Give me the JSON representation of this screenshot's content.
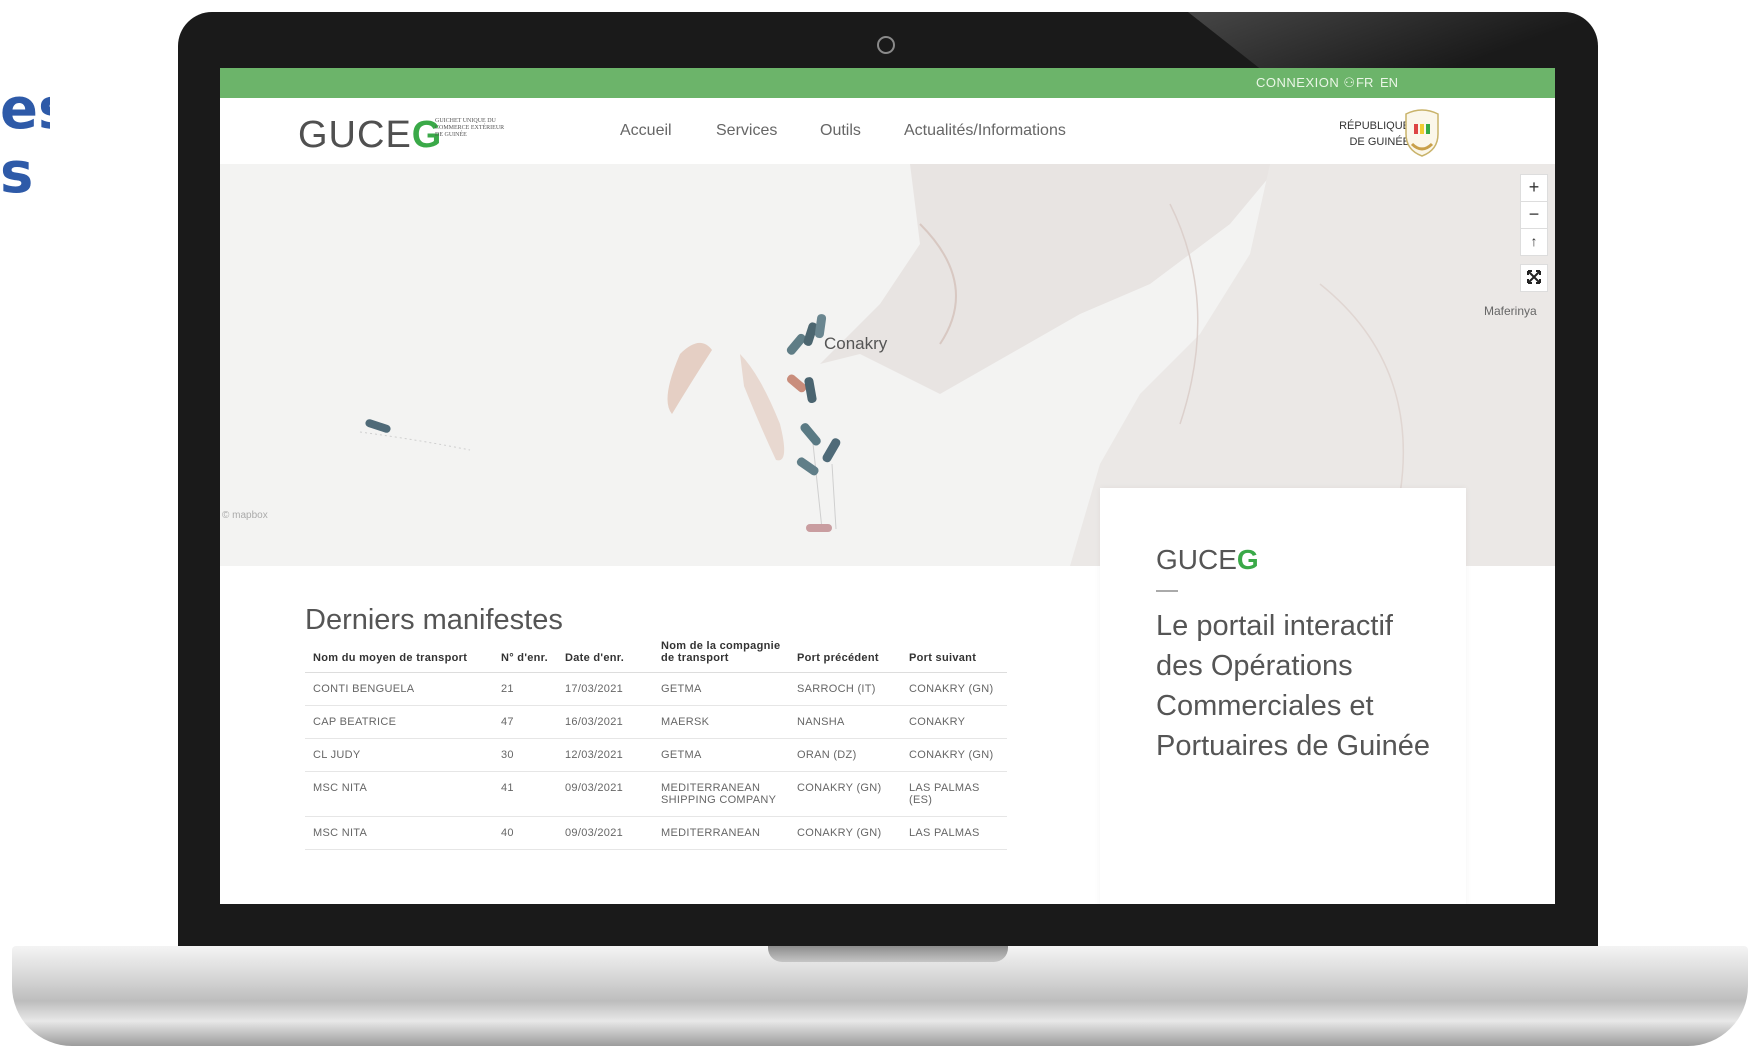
{
  "side_title": {
    "line1": "es",
    "line2": "s"
  },
  "topbar": {
    "login": "CONNEXION",
    "lang_fr": "FR",
    "lang_en": "EN"
  },
  "header": {
    "logo_main": "GUCE",
    "logo_accent": "G",
    "logo_sub": "GUICHET UNIQUE DU COMMERCE EXTÉRIEUR DE GUINÉE",
    "nav": [
      "Accueil",
      "Services",
      "Outils",
      "Actualités/Informations"
    ],
    "republic_line1": "RÉPUBLIQUE",
    "republic_line2": "DE GUINÉE"
  },
  "map": {
    "city_label": "Conakry",
    "place_label": "Maferinya",
    "zoom_in": "+",
    "zoom_out": "−",
    "compass": "↑",
    "attribution": "© mapbox"
  },
  "manifests": {
    "title": "Derniers manifestes",
    "columns": [
      "Nom du moyen de transport",
      "N° d'enr.",
      "Date d'enr.",
      "Nom de la compagnie de transport",
      "Port précédent",
      "Port suivant"
    ],
    "rows": [
      [
        "CONTI BENGUELA",
        "21",
        "17/03/2021",
        "GETMA",
        "SARROCH (IT)",
        "CONAKRY (GN)"
      ],
      [
        "CAP BEATRICE",
        "47",
        "16/03/2021",
        "MAERSK",
        "NANSHA",
        "CONAKRY"
      ],
      [
        "CL JUDY",
        "30",
        "12/03/2021",
        "GETMA",
        "ORAN (DZ)",
        "CONAKRY (GN)"
      ],
      [
        "MSC NITA",
        "41",
        "09/03/2021",
        "MEDITERRANEAN SHIPPING COMPANY",
        "CONAKRY (GN)",
        "LAS PALMAS (ES)"
      ],
      [
        "MSC NITA",
        "40",
        "09/03/2021",
        "MEDITERRANEAN",
        "CONAKRY (GN)",
        "LAS PALMAS"
      ]
    ]
  },
  "card": {
    "logo_main": "GUCE",
    "logo_accent": "G",
    "text": "Le portail interactif des Opérations Commerciales et Portuaires de Guinée"
  },
  "colors": {
    "green": "#6cb46a",
    "logo_green": "#3aa948",
    "title_blue": "#2e5aa8"
  }
}
